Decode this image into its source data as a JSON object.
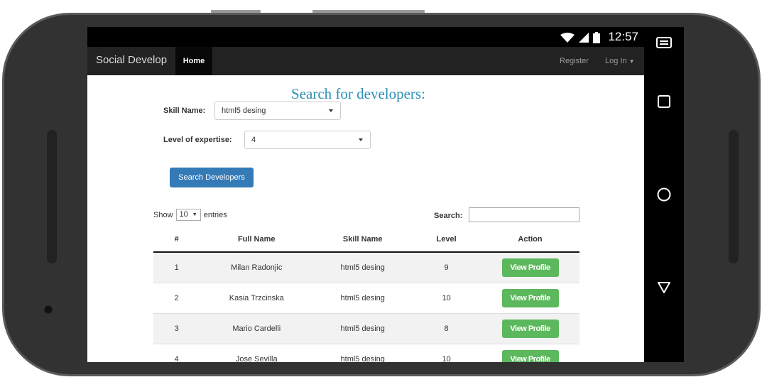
{
  "status": {
    "time": "12:57"
  },
  "navbar": {
    "brand": "Social Develop",
    "home": "Home",
    "register": "Register",
    "login": "Log In"
  },
  "form": {
    "title": "Search for developers:",
    "skill_label": "Skill Name:",
    "skill_value": "html5 desing",
    "level_label": "Level of expertise:",
    "level_value": "4",
    "search_button": "Search Developers"
  },
  "table_controls": {
    "show": "Show",
    "page_size": "10",
    "entries": "entries",
    "search_label": "Search:",
    "search_value": ""
  },
  "table": {
    "headers": [
      "#",
      "Full Name",
      "Skill Name",
      "Level",
      "Action"
    ],
    "rows": [
      {
        "num": "1",
        "name": "Milan Radonjic",
        "skill": "html5 desing",
        "level": "9",
        "action": "View Profile"
      },
      {
        "num": "2",
        "name": "Kasia Trzcinska",
        "skill": "html5 desing",
        "level": "10",
        "action": "View Profile"
      },
      {
        "num": "3",
        "name": "Mario Cardelli",
        "skill": "html5 desing",
        "level": "8",
        "action": "View Profile"
      },
      {
        "num": "4",
        "name": "Jose Sevilla",
        "skill": "html5 desing",
        "level": "10",
        "action": "View Profile"
      }
    ]
  },
  "icons": [
    "wifi-icon",
    "signal-icon",
    "battery-icon",
    "keyboard-icon",
    "recents-icon",
    "home-icon",
    "back-icon"
  ],
  "colors": {
    "title": "#2b8fb4",
    "primary_button": "#337ab7",
    "success_button": "#5cb85c",
    "navbar": "#222222"
  }
}
